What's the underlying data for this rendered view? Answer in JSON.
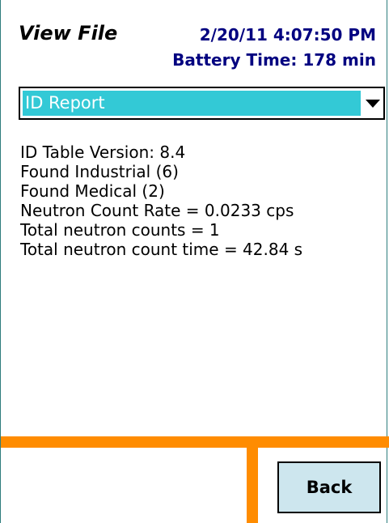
{
  "header": {
    "title": "View File",
    "datetime": "2/20/11 4:07:50 PM",
    "battery_label": "Battery Time:",
    "battery_value": "178 min",
    "title_color": "#000000",
    "info_color": "#000080"
  },
  "dropdown": {
    "selected": "ID Report",
    "highlight_color": "#33c9d6",
    "icon": "chevron-down-icon"
  },
  "report": {
    "lines": [
      "ID Table Version: 8.4",
      "Found Industrial (6)",
      "Found Medical (2)",
      "Neutron Count Rate = 0.0233 cps",
      "Total neutron counts = 1",
      "Total neutron count time = 42.84 s"
    ]
  },
  "footer": {
    "back_label": "Back",
    "accent_color": "#ff8c00",
    "button_color": "#cde6ee"
  }
}
